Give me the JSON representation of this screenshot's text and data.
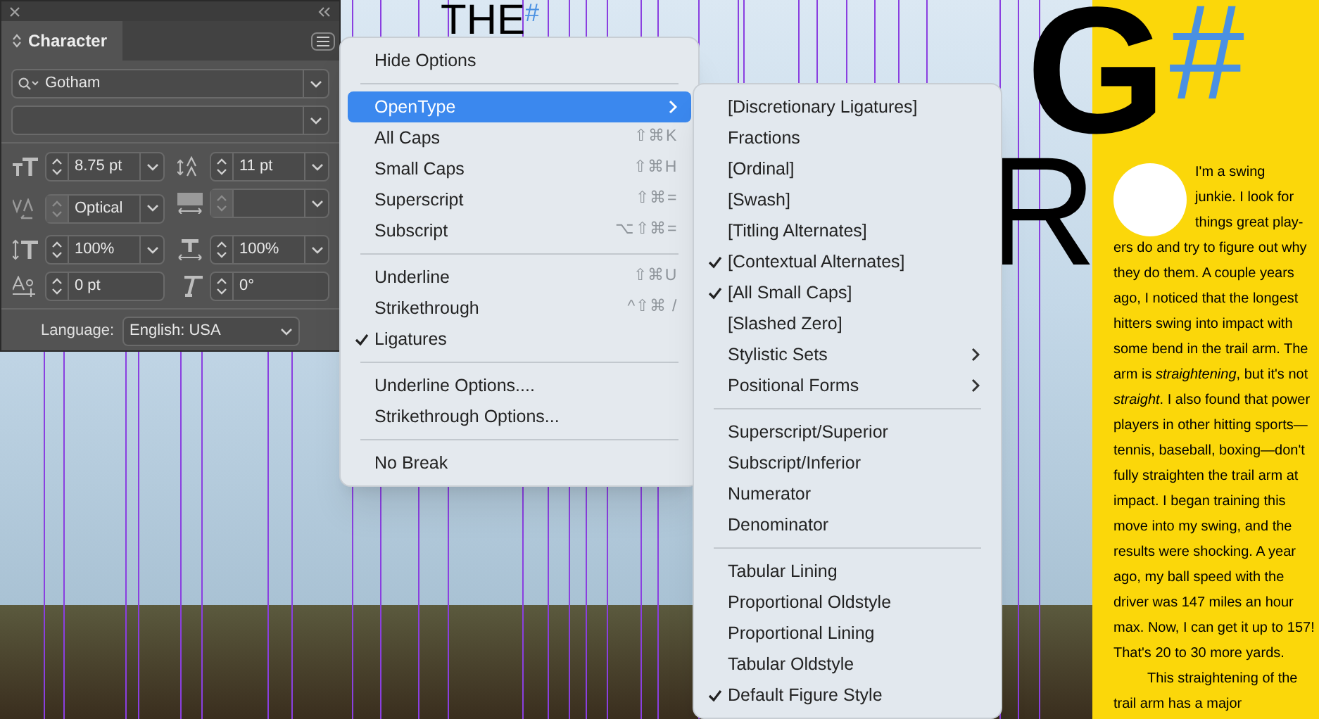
{
  "panel": {
    "title": "Character",
    "font_family": "Gotham",
    "fields": [
      {
        "kind": "font_size",
        "value": "8.75 pt",
        "disabled": false
      },
      {
        "kind": "leading",
        "value": "11 pt",
        "disabled": false
      },
      {
        "kind": "kerning",
        "value": "Optical",
        "disabled": true
      },
      {
        "kind": "tracking",
        "disabled": true
      },
      {
        "kind": "vertical_scale",
        "value": "100%",
        "disabled": false
      },
      {
        "kind": "horizontal_scale",
        "value": "100%",
        "disabled": false
      },
      {
        "kind": "baseline_shift",
        "value": "0 pt",
        "disabled": false
      },
      {
        "kind": "skew",
        "value": "0°",
        "disabled": false
      }
    ],
    "language_label": "Language:",
    "language": "English: USA"
  },
  "menu": [
    {
      "kind": "item",
      "label": "Hide Options",
      "checked": false,
      "selected": false
    },
    {
      "kind": "separator"
    },
    {
      "kind": "submenu",
      "label": "OpenType",
      "checked": false,
      "selected": true
    },
    {
      "kind": "item",
      "label": "All Caps",
      "shortcut": "⇧⌘K",
      "checked": false,
      "selected": false
    },
    {
      "kind": "item",
      "label": "Small Caps",
      "shortcut": "⇧⌘H",
      "checked": false,
      "selected": false
    },
    {
      "kind": "item",
      "label": "Superscript",
      "shortcut": "⇧⌘=",
      "checked": false,
      "selected": false
    },
    {
      "kind": "item",
      "label": "Subscript",
      "shortcut": "⌥⇧⌘=",
      "checked": false,
      "selected": false
    },
    {
      "kind": "separator"
    },
    {
      "kind": "item",
      "label": "Underline",
      "shortcut": "⇧⌘U",
      "checked": false,
      "selected": false
    },
    {
      "kind": "item",
      "label": "Strikethrough",
      "shortcut": "^⇧⌘ /",
      "checked": false,
      "selected": false
    },
    {
      "kind": "item",
      "label": "Ligatures",
      "checked": true,
      "selected": false
    },
    {
      "kind": "separator"
    },
    {
      "kind": "item",
      "label": "Underline Options....",
      "checked": false,
      "selected": false
    },
    {
      "kind": "item",
      "label": "Strikethrough Options...",
      "checked": false,
      "selected": false
    },
    {
      "kind": "separator"
    },
    {
      "kind": "item",
      "label": "No Break",
      "checked": false,
      "selected": false
    }
  ],
  "submenu": [
    {
      "kind": "item",
      "label": "[Discretionary Ligatures]",
      "checked": false
    },
    {
      "kind": "item",
      "label": "Fractions",
      "checked": false
    },
    {
      "kind": "item",
      "label": "[Ordinal]",
      "checked": false
    },
    {
      "kind": "item",
      "label": "[Swash]",
      "checked": false
    },
    {
      "kind": "item",
      "label": "[Titling Alternates]",
      "checked": false
    },
    {
      "kind": "item",
      "label": "[Contextual Alternates]",
      "checked": true
    },
    {
      "kind": "item",
      "label": "[All Small Caps]",
      "checked": true
    },
    {
      "kind": "item",
      "label": "[Slashed Zero]",
      "checked": false
    },
    {
      "kind": "submenu",
      "label": "Stylistic Sets",
      "checked": false
    },
    {
      "kind": "submenu",
      "label": "Positional Forms",
      "checked": false
    },
    {
      "kind": "separator"
    },
    {
      "kind": "item",
      "label": "Superscript/Superior",
      "checked": false
    },
    {
      "kind": "item",
      "label": "Subscript/Inferior",
      "checked": false
    },
    {
      "kind": "item",
      "label": "Numerator",
      "checked": false
    },
    {
      "kind": "item",
      "label": "Denominator",
      "checked": false
    },
    {
      "kind": "separator"
    },
    {
      "kind": "item",
      "label": "Tabular Lining",
      "checked": false
    },
    {
      "kind": "item",
      "label": "Proportional Oldstyle",
      "checked": false
    },
    {
      "kind": "item",
      "label": "Proportional Lining",
      "checked": false
    },
    {
      "kind": "item",
      "label": "Tabular Oldstyle",
      "checked": false
    },
    {
      "kind": "item",
      "label": "Default Figure Style",
      "checked": true
    }
  ],
  "layout": {
    "headline_small": "THE",
    "headline_hash": "#",
    "headline": "G",
    "headline_hash_2": "#",
    "second_line": "R",
    "paragraphs": [
      "I'm a swing junkie. I look for things great play-",
      "ers do and try to figure out why they do them. A couple years ago, I noticed that the longest hitters swing into impact with some bend in the trail arm. The arm is *straightening*, but it's not *straight*. I also found that power players in other hitting sports—tennis, baseball, boxing—don't fully straighten the trail arm at impact. I began training this move into my swing, and the results were shocking. A year ago, my ball speed with the driver was 147 miles an hour max. Now, I can get it up to 157! That's 20 to 30 more yards.",
      "This straightening of the trail arm has a major"
    ]
  }
}
